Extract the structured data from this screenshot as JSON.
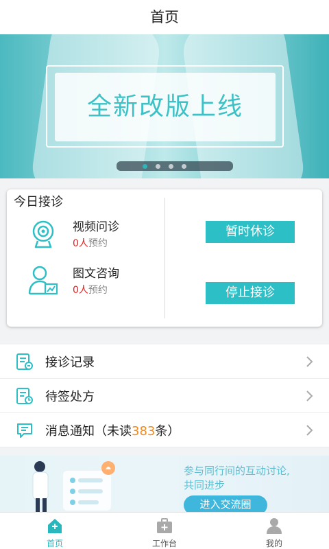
{
  "header": {
    "title": "首页"
  },
  "banner": {
    "headline": "全新改版上线",
    "slide_index": 1,
    "slide_count": 4
  },
  "today": {
    "title": "今日接诊",
    "services": [
      {
        "name": "视频问诊",
        "count": "0",
        "unit": "人",
        "suffix": "预约",
        "icon": "webcam-icon"
      },
      {
        "name": "图文咨询",
        "count": "0",
        "unit": "人",
        "suffix": "预约",
        "icon": "user-chart-icon"
      }
    ],
    "actions": {
      "pause_label": "暂时休诊",
      "stop_label": "停止接诊"
    }
  },
  "menu": [
    {
      "label": "接诊记录",
      "icon": "record-icon"
    },
    {
      "label": "待签处方",
      "icon": "prescription-icon"
    },
    {
      "label_prefix": "消息通知（未读",
      "unread": "383",
      "label_suffix": "条）",
      "icon": "message-icon"
    }
  ],
  "promo": {
    "line1": "参与同行间的互动讨论,",
    "line2": "共同进步",
    "button_label": "进入交流圈"
  },
  "tabs": [
    {
      "label": "首页",
      "active": true,
      "icon": "home-icon"
    },
    {
      "label": "工作台",
      "active": false,
      "icon": "briefcase-icon"
    },
    {
      "label": "我的",
      "active": false,
      "icon": "person-icon"
    }
  ],
  "colors": {
    "accent": "#2cbfc5",
    "count_red": "#e02020",
    "unread_orange": "#f08a1e"
  }
}
